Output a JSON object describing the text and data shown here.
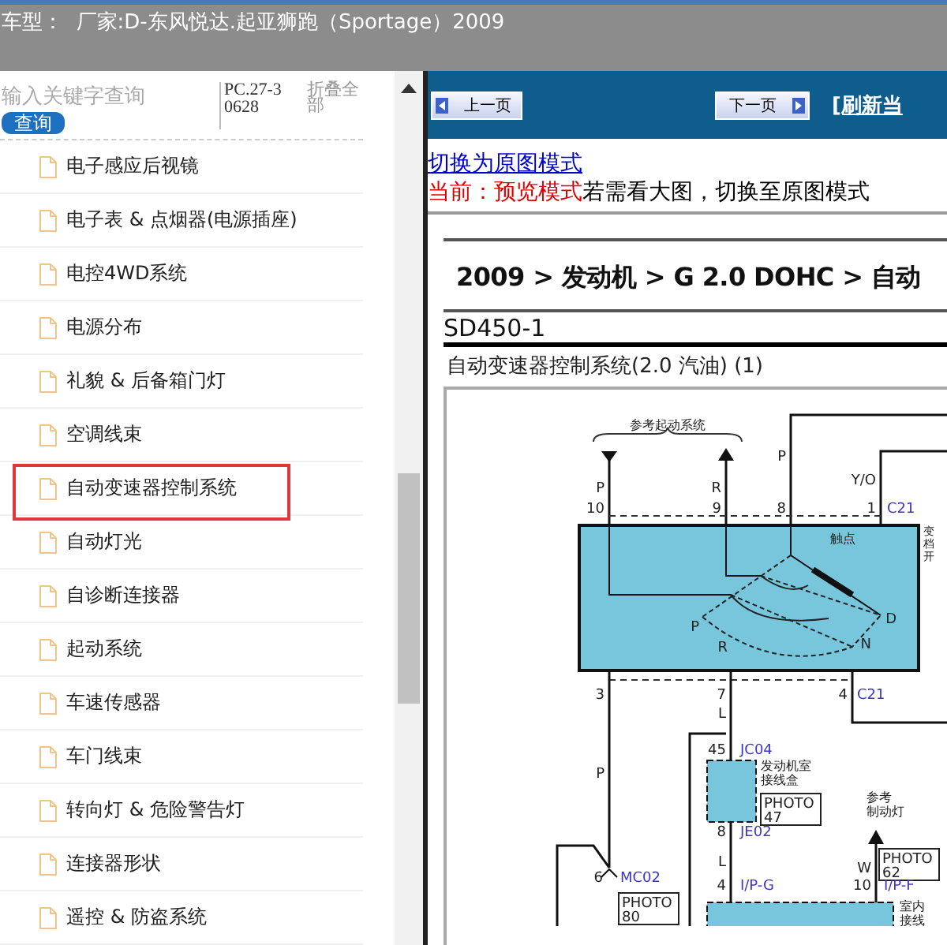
{
  "title_bar": {
    "text": "车型：  厂家:D-东风悦达.起亚狮跑（Sportage）2009"
  },
  "sidebar": {
    "search": {
      "placeholder": "输入关键字查询"
    },
    "search_button": "查询",
    "code": "PC.27-30628",
    "collapse_all": "折叠全部",
    "items": [
      {
        "label": "电子感应后视镜",
        "selected": false
      },
      {
        "label": "电子表 & 点烟器(电源插座)",
        "selected": false
      },
      {
        "label": "电控4WD系统",
        "selected": false
      },
      {
        "label": "电源分布",
        "selected": false
      },
      {
        "label": "礼貌 & 后备箱门灯",
        "selected": false
      },
      {
        "label": "空调线束",
        "selected": false
      },
      {
        "label": "自动变速器控制系统",
        "selected": true
      },
      {
        "label": "自动灯光",
        "selected": false
      },
      {
        "label": "自诊断连接器",
        "selected": false
      },
      {
        "label": "起动系统",
        "selected": false
      },
      {
        "label": "车速传感器",
        "selected": false
      },
      {
        "label": "车门线束",
        "selected": false
      },
      {
        "label": "转向灯 & 危险警告灯",
        "selected": false
      },
      {
        "label": "连接器形状",
        "selected": false
      },
      {
        "label": "遥控 & 防盗系统",
        "selected": false
      }
    ]
  },
  "toolbar": {
    "prev": "上一页",
    "next": "下一页",
    "refresh": "[刷新当"
  },
  "mode_link": "切换为原图模式",
  "mode_status": {
    "current": "当前：预览模式",
    "hint": "若需看大图，切换至原图模式"
  },
  "document": {
    "breadcrumb": "2009 > 发动机 > G 2.0 DOHC > 自动",
    "code": "SD450-1",
    "title": "自动变速器控制系统(2.0  汽油) (1)",
    "diagram": {
      "labels": [
        {
          "kind": "note",
          "lines": [
            "参考起动系统"
          ]
        },
        {
          "kind": "wire",
          "text": "P"
        },
        {
          "kind": "wire",
          "text": "R"
        },
        {
          "kind": "wire",
          "text": "P"
        },
        {
          "kind": "wire",
          "text": "Y/O"
        },
        {
          "kind": "pin",
          "text": "10"
        },
        {
          "kind": "pin",
          "text": "9"
        },
        {
          "kind": "pin",
          "text": "8"
        },
        {
          "kind": "pin",
          "text": "1"
        },
        {
          "kind": "connector",
          "text": "C21"
        },
        {
          "kind": "note",
          "lines": [
            "变",
            "档",
            "开"
          ]
        },
        {
          "kind": "note",
          "lines": [
            "触点"
          ]
        },
        {
          "kind": "wire",
          "text": "P"
        },
        {
          "kind": "wire",
          "text": "R"
        },
        {
          "kind": "wire",
          "text": "N"
        },
        {
          "kind": "wire",
          "text": "D"
        },
        {
          "kind": "pin",
          "text": "3"
        },
        {
          "kind": "pin",
          "text": "7"
        },
        {
          "kind": "pin",
          "text": "4"
        },
        {
          "kind": "connector",
          "text": "C21"
        },
        {
          "kind": "wire",
          "text": "L"
        },
        {
          "kind": "wire",
          "text": "P"
        },
        {
          "kind": "pin",
          "text": "45"
        },
        {
          "kind": "connector",
          "text": "JC04"
        },
        {
          "kind": "note",
          "lines": [
            "发动机室",
            "接线盒"
          ]
        },
        {
          "kind": "photo",
          "lines": [
            "PHOTO",
            "47"
          ]
        },
        {
          "kind": "pin",
          "text": "8"
        },
        {
          "kind": "connector",
          "text": "JE02"
        },
        {
          "kind": "wire",
          "text": "L"
        },
        {
          "kind": "note",
          "lines": [
            "参考",
            "制动灯"
          ]
        },
        {
          "kind": "wire",
          "text": "W"
        },
        {
          "kind": "photo",
          "lines": [
            "PHOTO",
            "62"
          ]
        },
        {
          "kind": "pin",
          "text": "4"
        },
        {
          "kind": "connector",
          "text": "I/P-G"
        },
        {
          "kind": "pin",
          "text": "10"
        },
        {
          "kind": "connector",
          "text": "I/P-F"
        },
        {
          "kind": "pin",
          "text": "6"
        },
        {
          "kind": "connector",
          "text": "MC02"
        },
        {
          "kind": "photo",
          "lines": [
            "PHOTO",
            "80"
          ]
        },
        {
          "kind": "note",
          "lines": [
            "室内",
            "接线"
          ]
        }
      ]
    }
  }
}
